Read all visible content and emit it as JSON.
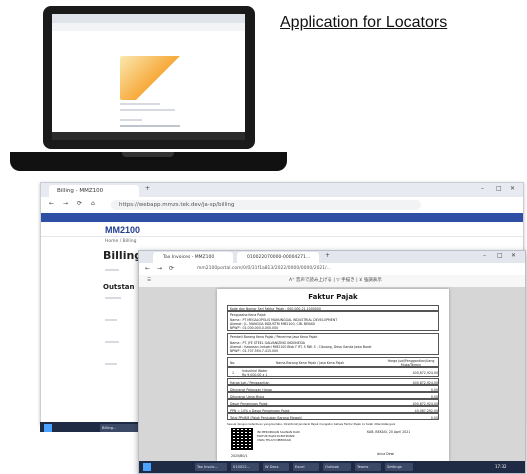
{
  "heading": {
    "text": "Application for Locators"
  },
  "window1": {
    "tab_title": "Billing - MMZ100",
    "url": "https://webapp.mmzs.tek.dev/ja-sp/billing",
    "logo": "MM2100",
    "breadcrumb": "Home / Billing",
    "page_title": "Billing",
    "section_title": "Outstan"
  },
  "window2": {
    "tab1": "Tax Invoices - MMZ100",
    "tab2": "010022070000-00004271...",
    "url": "mm2100portal.com/0/0/31f1a813/2022/0000/0000/2021/...",
    "toolbar_text": "A⁺ 音声で読み上げる | ▽ 手描き | ⊻ 強調表示",
    "pdf": {
      "title": "Faktur Pajak",
      "code_line": "Kode dan Nomor Seri Faktur Pajak : 000.000-21.1000000",
      "seller_header": "Pengusaha Kena Pajak",
      "seller_name": "Nama : PT MEGALOPOLIS MANUNGGAL INDUSTRIAL DEVELOPMENT",
      "seller_addr": "Alamat : JL. MANGGA INDUSTRI MM2100, CIB. BEKASI",
      "seller_npwp": "NPWP : 01.000.000.0-000.000",
      "buyer_header": "Pembeli Barang Kena Pajak / Penerima Jasa Kena Pajak",
      "buyer_name": "Nama : PT. JFE STEEL GALVANIZING INDONESIA",
      "buyer_addr": "Alamat : Kawasan Industri MM2100 Blok F RT. 5 RW. 5 , Cibuang, Desa Ganda Jawa Barat",
      "buyer_npwp": "NPWP : 01.707.594.7-415.000",
      "col_no": "No.",
      "col_name": "Nama Barang Kena Pajak / Jasa Kena Pajak",
      "col_price": "Harga Jual/Penggantian/Uang Muka/Termin",
      "item_no": "1",
      "item_name": "Industrial Water",
      "item_detail": "Rp 9,000.00 x 1",
      "item_amount": "400,872,924.00",
      "rows": [
        {
          "label": "Harga Jual / Penggantian",
          "amount": "400,872,924.00"
        },
        {
          "label": "Dikurangi Potongan Harga",
          "amount": "0.00"
        },
        {
          "label": "Dikurangi Uang Muka",
          "amount": "0.00"
        },
        {
          "label": "Dasar Pengenaan Pajak",
          "amount": "400,872,924.00"
        },
        {
          "label": "PPN = 10% x Dasar Pengenaan Pajak",
          "amount": "40,087,292.00"
        },
        {
          "label": "Total PPnBM (Pajak Penjualan Barang Mewah)",
          "amount": "0.00"
        }
      ],
      "footer_note": "Sesuai dengan ketentuan yang berlaku, Direktorat Jenderal Pajak mengatur bahwa Faktur Pajak ini telah ditandatangani",
      "city_date": "KAB. BEKASI, 20 April 2021",
      "qr_note": "INI MERUPAKAN SALINAN DARI FAKTUR PAJAK ELEKTRONIK YANG TELAH DIBERIKAN",
      "signer": "Anna Dewi",
      "doc_id": "2020/B0/1"
    }
  },
  "taskbar": {
    "items": [
      "Billing...",
      "Tax Invoic...",
      "010022...",
      "W Docs",
      "Excel",
      "Outlook",
      "Teams",
      "Settings"
    ],
    "time": "17:32"
  }
}
